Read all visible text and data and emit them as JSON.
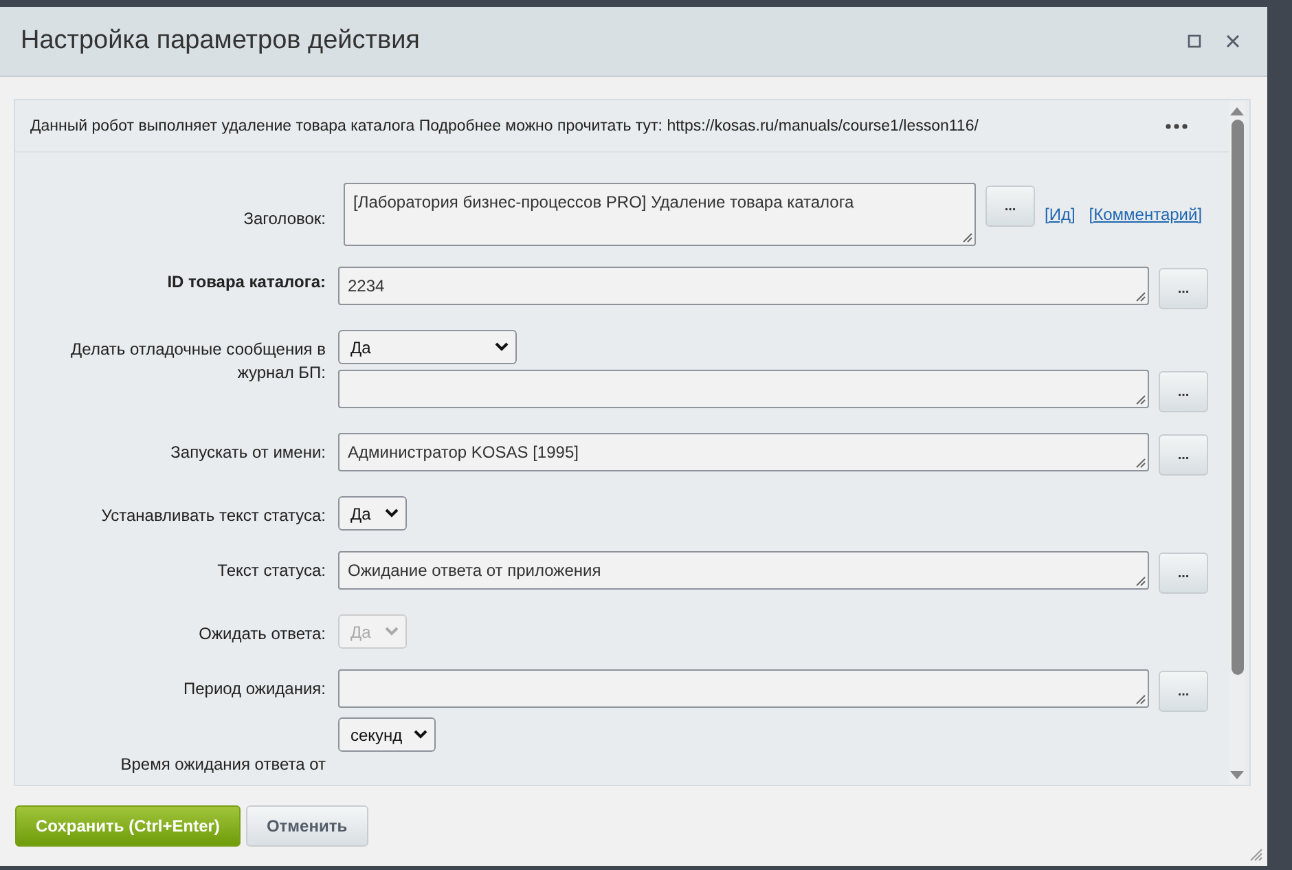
{
  "window": {
    "title": "Настройка параметров действия"
  },
  "description": "Данный робот выполняет удаление товара каталога Подробнее можно прочитать тут: https://kosas.ru/manuals/course1/lesson116/",
  "fields": [
    {
      "label": "Заголовок:",
      "bold": false,
      "controls": [
        {
          "kind": "textarea",
          "value": "[Лаборатория бизнес-процессов PRO] Удаление товара каталога",
          "tall": true,
          "button": "...",
          "links": [
            "[Ид]",
            "[Комментарий]"
          ]
        }
      ]
    },
    {
      "label": "ID товара каталога:",
      "bold": true,
      "controls": [
        {
          "kind": "textarea",
          "value": "2234",
          "button": "..."
        }
      ]
    },
    {
      "label": "Делать отладочные сообщения в журнал БП:",
      "bold": false,
      "controls": [
        {
          "kind": "select",
          "value": "Да",
          "wide": true,
          "disabled": false
        },
        {
          "kind": "textarea",
          "button": "..."
        }
      ]
    },
    {
      "label": "Запускать от имени:",
      "bold": false,
      "controls": [
        {
          "kind": "textarea",
          "value": "Администратор KOSAS [1995]",
          "button": "..."
        }
      ]
    },
    {
      "label": "Устанавливать текст статуса:",
      "bold": false,
      "controls": [
        {
          "kind": "select",
          "value": "Да",
          "wide": false,
          "disabled": false
        }
      ]
    },
    {
      "label": "Текст статуса:",
      "bold": false,
      "controls": [
        {
          "kind": "textarea",
          "value": "Ожидание ответа от приложения",
          "button": "..."
        }
      ]
    },
    {
      "label": "Ожидать ответа:",
      "bold": false,
      "controls": [
        {
          "kind": "select",
          "value": "Да",
          "wide": false,
          "disabled": true
        }
      ]
    },
    {
      "label": "Период ожидания:",
      "bold": false,
      "controls": [
        {
          "kind": "textarea",
          "button": "..."
        },
        {
          "kind": "select",
          "value": "секунд",
          "wide": false,
          "disabled": false
        }
      ]
    },
    {
      "label": "Время ожидания ответа от",
      "bold": false
    }
  ],
  "buttons": [
    {
      "label": "Сохранить (Ctrl+Enter)",
      "primary": true
    },
    {
      "label": "Отменить",
      "primary": false
    }
  ]
}
